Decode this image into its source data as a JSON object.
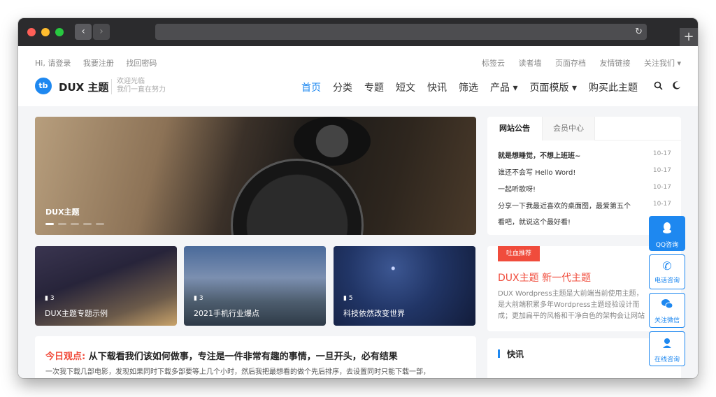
{
  "topbar": {
    "left_links": [
      "Hi, 请登录",
      "我要注册",
      "找回密码"
    ],
    "right_links": [
      "标签云",
      "读者墙",
      "页面存档",
      "友情链接",
      "关注我们 ▾"
    ]
  },
  "brand": {
    "logo_text": "tb",
    "name": "DUX 主题",
    "slogan1": "欢迎光临",
    "slogan2": "我们一直在努力"
  },
  "nav": {
    "items": [
      "首页",
      "分类",
      "专题",
      "短文",
      "快讯",
      "筛选",
      "产品 ▾",
      "页面模版 ▾",
      "购买此主题"
    ],
    "active": "首页"
  },
  "icons": {
    "search": "search-icon",
    "theme": "moon-icon"
  },
  "banner": {
    "caption": "DUX主题"
  },
  "cards": [
    {
      "count": "3",
      "title": "DUX主题专题示例"
    },
    {
      "count": "3",
      "title": "2021手机行业爆点"
    },
    {
      "count": "5",
      "title": "科技依然改变世界"
    }
  ],
  "opinion": {
    "label": "今日观点:",
    "title": "从下载看我们该如何做事，专注是一件非常有趣的事情，一旦开头，必有结果",
    "excerpt": "一次我下载几部电影，发现如果同时下载多部要等上几个小时，然后我把最想看的做个先后排序，去设置同时只能下载一部，"
  },
  "notice": {
    "tabs": [
      "网站公告",
      "会员中心"
    ],
    "items": [
      {
        "text": "就是想睡觉，不想上班班~",
        "date": "10-17"
      },
      {
        "text": "谁还不会写 Hello Word!",
        "date": "10-17"
      },
      {
        "text": "一起听歌呀!",
        "date": "10-17"
      },
      {
        "text": "分享一下我最近喜欢的桌面图，最爱第五个",
        "date": "10-17"
      },
      {
        "text": "看吧，就说这个最好看!",
        "date": ""
      }
    ]
  },
  "recommend": {
    "tag": "吐血推荐",
    "title": "DUX主题 新一代主题",
    "desc": "DUX Wordpress主题是大前端当前使用主题，是大前端积累多年Wordpress主题经验设计而成；更加扁平的风格和干净白色的架构会让网站显得内涵而出色。"
  },
  "flash": {
    "title": "快讯"
  },
  "float_buttons": [
    {
      "label": "QQ咨询",
      "icon": "qq-icon"
    },
    {
      "label": "电话咨询",
      "icon": "phone-icon"
    },
    {
      "label": "关注微信",
      "icon": "wechat-icon"
    },
    {
      "label": "在线咨询",
      "icon": "headset-icon"
    }
  ],
  "colors": {
    "accent": "#1e88f0",
    "red": "#f04c3c"
  }
}
